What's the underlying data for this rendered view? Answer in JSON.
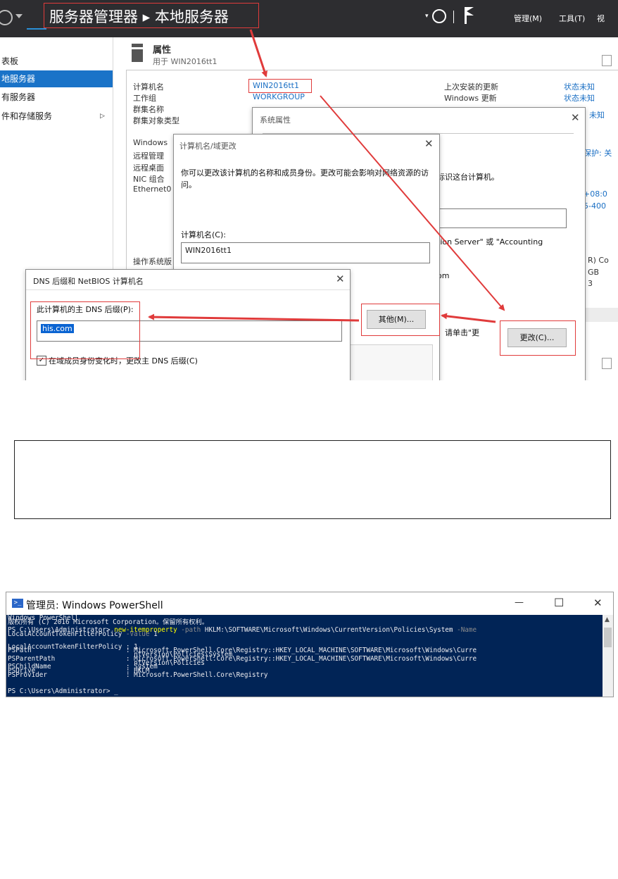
{
  "server_manager": {
    "breadcrumb": "服务器管理器 ▸ 本地服务器",
    "top_menu": {
      "manage": "管理(M)",
      "tools": "工具(T)",
      "view": "视"
    },
    "nav_items": [
      {
        "label": "表板"
      },
      {
        "label": "地服务器"
      },
      {
        "label": "有服务器"
      },
      {
        "label": "件和存储服务"
      }
    ],
    "properties_title": "属性",
    "properties_subtitle": "用于 WIN2016tt1",
    "left_labels": [
      "计算机名",
      "工作组",
      "群集名称",
      "群集对象类型",
      "Windows",
      "远程管理",
      "远程桌面",
      "NIC 组合",
      "Ethernet0",
      "操作系统版"
    ],
    "computer_name_value": "WIN2016tt1",
    "workgroup_value": "WORKGROUP",
    "right_labels": [
      "上次安装的更新",
      "Windows 更新"
    ],
    "right_values": [
      "状态未知",
      "状态未知",
      "未知"
    ],
    "right_edge_texts": [
      "保护: 关",
      "+08:0",
      "5-400",
      "R) Co",
      "GB",
      "3"
    ]
  },
  "sys_props": {
    "title": "系统属性",
    "desc": "标识这台计算机。",
    "server_note": "tion Server\" 或 \"Accounting",
    "dom_text": "om",
    "click_text": "，请单击\"更",
    "change_button": "更改(C)..."
  },
  "name_change": {
    "title": "计算机名/域更改",
    "description": "你可以更改该计算机的名称和成员身份。更改可能会影响对网络资源的访问。",
    "computer_name_label": "计算机名(C):",
    "computer_name_value": "WIN2016tt1",
    "other_button": "其他(M)..."
  },
  "dns_dialog": {
    "title": "DNS 后缀和 NetBIOS 计算机名",
    "suffix_label": "此计算机的主 DNS 后缀(P):",
    "suffix_value": "his.com",
    "checkbox_label": "在域成员身份变化时，更改主 DNS 后缀(C)",
    "checkbox_checked": true
  },
  "powershell": {
    "title": "管理员: Windows PowerShell",
    "minimize": "—",
    "maximize": "☐",
    "close": "✕",
    "lines": [
      "Windows PowerShell",
      "版权所有 (C) 2016 Microsoft Corporation。保留所有权利。",
      "",
      "PS C:\\Users\\Administrator> new-itemproperty -path HKLM:\\SOFTWARE\\Microsoft\\Windows\\CurrentVersion\\Policies\\System -Name",
      "LocalAccountTokenFilterPolicy -Value 1",
      "",
      "",
      "LocalAccountTokenFilterPolicy : 1",
      "PSPath                        : Microsoft.PowerShell.Core\\Registry::HKEY_LOCAL_MACHINE\\SOFTWARE\\Microsoft\\Windows\\Curre",
      "                                ntVersion\\Policies\\System",
      "PSParentPath                  : Microsoft.PowerShell.Core\\Registry::HKEY_LOCAL_MACHINE\\SOFTWARE\\Microsoft\\Windows\\Curre",
      "                                ntVersion\\Policies",
      "PSChildName                   : System",
      "PSDrive                       : HKLM",
      "PSProvider                    : Microsoft.PowerShell.Core\\Registry",
      "",
      "",
      "",
      "PS C:\\Users\\Administrator> _"
    ]
  },
  "colors": {
    "annotation_red": "#e03b3b",
    "selection_blue": "#1a73c8",
    "powershell_bg": "#012456",
    "powershell_cmd": "#ffff00"
  }
}
